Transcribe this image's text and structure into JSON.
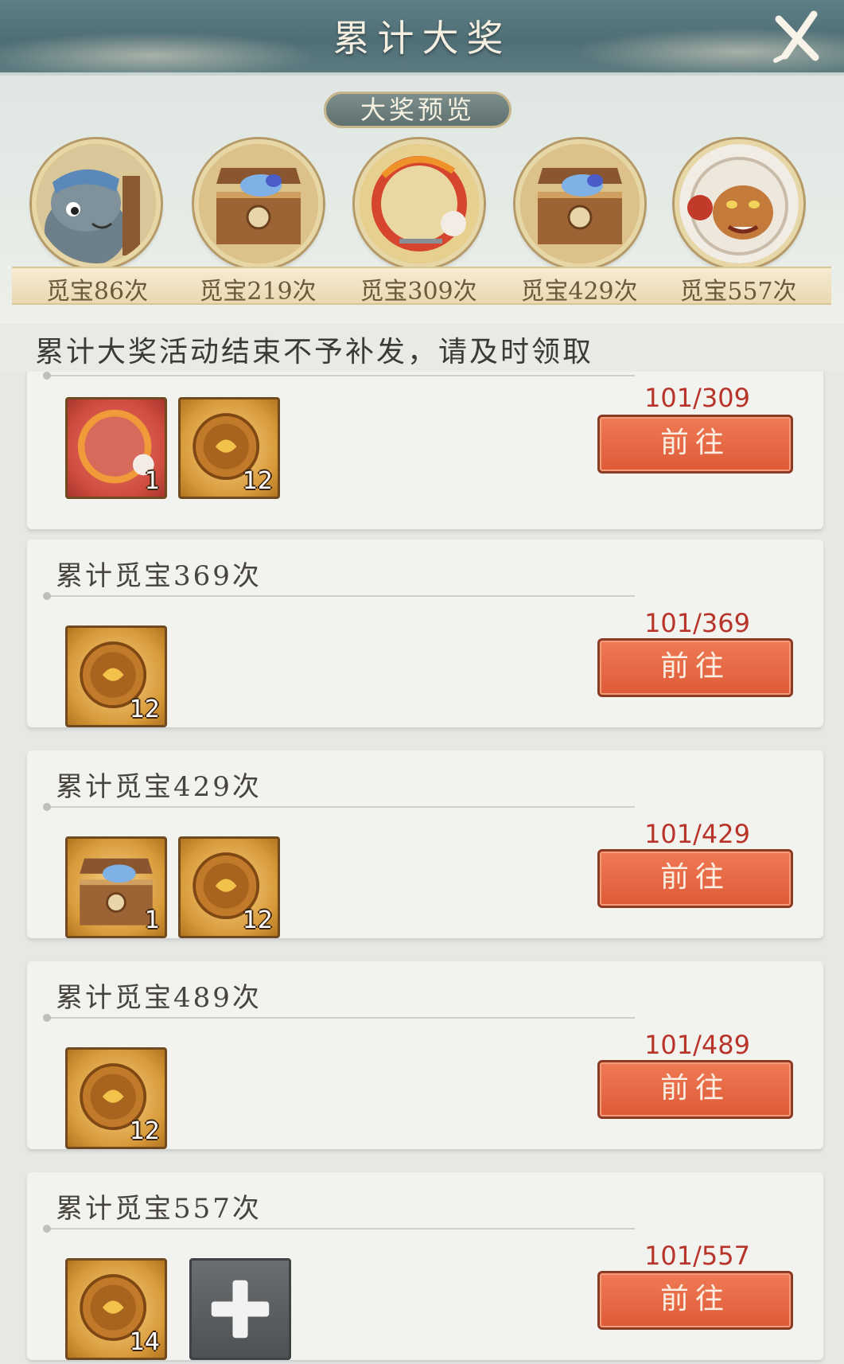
{
  "header": {
    "title": "累计大奖"
  },
  "preview": {
    "label": "大奖预览",
    "items": [
      {
        "label": "觅宝86次",
        "icon": "character-portrait-icon"
      },
      {
        "label": "觅宝219次",
        "icon": "treasure-chest-icon"
      },
      {
        "label": "觅宝309次",
        "icon": "avatar-frame-icon"
      },
      {
        "label": "觅宝429次",
        "icon": "treasure-chest-icon"
      },
      {
        "label": "觅宝557次",
        "icon": "lion-beast-icon"
      }
    ]
  },
  "notice": "累计大奖活动结束不予补发，请及时领取",
  "cards": [
    {
      "title": "",
      "progress": "101/309",
      "button": "前往",
      "items": [
        {
          "icon": "avatar-frame-icon",
          "qty": "1"
        },
        {
          "icon": "gold-coin-icon",
          "qty": "12"
        }
      ]
    },
    {
      "title": "累计觅宝369次",
      "progress": "101/369",
      "button": "前往",
      "items": [
        {
          "icon": "gold-coin-icon",
          "qty": "12"
        }
      ]
    },
    {
      "title": "累计觅宝429次",
      "progress": "101/429",
      "button": "前往",
      "items": [
        {
          "icon": "treasure-chest-icon",
          "qty": "1"
        },
        {
          "icon": "gold-coin-icon",
          "qty": "12"
        }
      ]
    },
    {
      "title": "累计觅宝489次",
      "progress": "101/489",
      "button": "前往",
      "items": [
        {
          "icon": "gold-coin-icon",
          "qty": "12"
        }
      ]
    },
    {
      "title": "累计觅宝557次",
      "progress": "101/557",
      "button": "前往",
      "items": [
        {
          "icon": "gold-coin-icon",
          "qty": "14"
        },
        {
          "icon": "plus-icon",
          "qty": ""
        }
      ]
    }
  ]
}
